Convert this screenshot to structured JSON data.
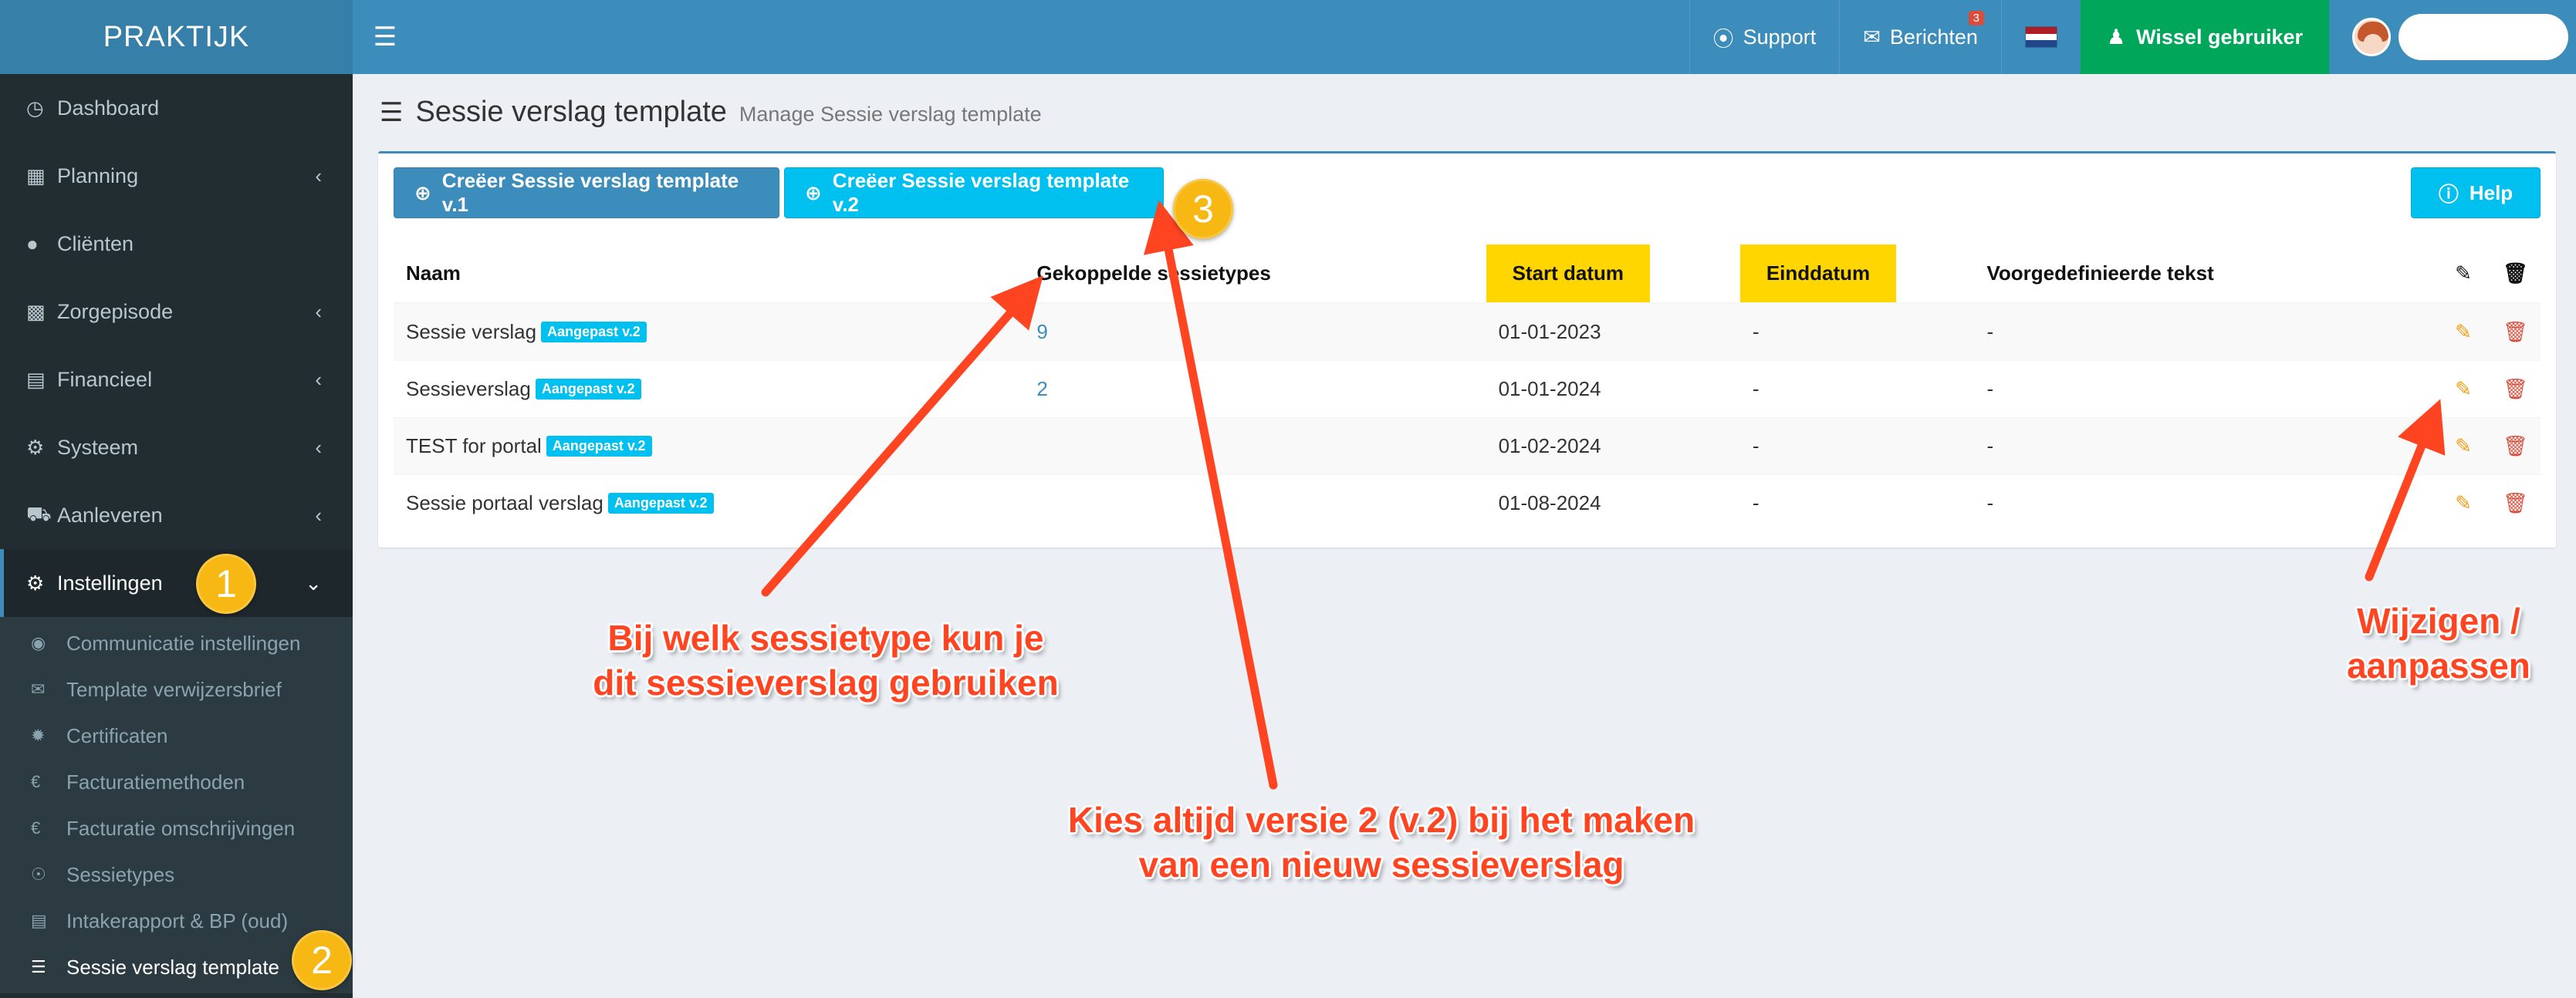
{
  "app": {
    "logo": "PRAKTIJK"
  },
  "topbar": {
    "support_label": "Support",
    "berichten_label": "Berichten",
    "berichten_count": "3",
    "wissel_label": "Wissel gebruiker"
  },
  "sidebar": {
    "items": [
      {
        "label": "Dashboard"
      },
      {
        "label": "Planning"
      },
      {
        "label": "Cliënten"
      },
      {
        "label": "Zorgepisode"
      },
      {
        "label": "Financieel"
      },
      {
        "label": "Systeem"
      },
      {
        "label": "Aanleveren"
      },
      {
        "label": "Instellingen"
      }
    ],
    "submenu": [
      {
        "label": "Communicatie instellingen"
      },
      {
        "label": "Template verwijzersbrief"
      },
      {
        "label": "Certificaten"
      },
      {
        "label": "Facturatiemethoden"
      },
      {
        "label": "Facturatie omschrijvingen"
      },
      {
        "label": "Sessietypes"
      },
      {
        "label": "Intakerapport & BP (oud)"
      },
      {
        "label": "Sessie verslag template"
      }
    ]
  },
  "page": {
    "title": "Sessie verslag template",
    "subtitle": "Manage Sessie verslag template"
  },
  "toolbar": {
    "create_v1": "Creëer Sessie verslag template v.1",
    "create_v2": "Creëer Sessie verslag template v.2",
    "help": "Help"
  },
  "table": {
    "headers": {
      "naam": "Naam",
      "gekoppelde": "Gekoppelde sessietypes",
      "start": "Start datum",
      "eind": "Einddatum",
      "voorgedefinieerd": "Voorgedefinieerde tekst"
    },
    "rows": [
      {
        "naam": "Sessie verslag",
        "badge": "Aangepast v.2",
        "gekoppelde": "9",
        "start": "01-01-2023",
        "eind": "-",
        "voor": "-"
      },
      {
        "naam": "Sessieverslag",
        "badge": "Aangepast v.2",
        "gekoppelde": "2",
        "start": "01-01-2024",
        "eind": "-",
        "voor": "-"
      },
      {
        "naam": "TEST for portal",
        "badge": "Aangepast v.2",
        "gekoppelde": "",
        "start": "01-02-2024",
        "eind": "-",
        "voor": "-"
      },
      {
        "naam": "Sessie portaal verslag",
        "badge": "Aangepast v.2",
        "gekoppelde": "",
        "start": "01-08-2024",
        "eind": "-",
        "voor": "-"
      }
    ]
  },
  "annotations": {
    "markers": [
      "1",
      "2",
      "3"
    ],
    "sessietype_line1": "Bij welk sessietype kun je",
    "sessietype_line2": "dit sessieverslag gebruiken",
    "versie_line1": "Kies altijd versie 2 (v.2) bij het maken",
    "versie_line2": "van een nieuw sessieverslag",
    "wijzigen_line1": "Wijzigen /",
    "wijzigen_line2": "aanpassen"
  },
  "icons": {
    "hamburger": "menu-icon",
    "support": "lifebuoy-icon",
    "berichten": "envelope-icon",
    "wissel": "user-secret-icon",
    "edit": "pencil-icon",
    "delete": "trash-icon"
  },
  "colors": {
    "header": "#3c8dbc",
    "logo_bg": "#367fa9",
    "sidebar": "#222d32",
    "wissel_bg": "#00a65a",
    "info_button": "#00c0ef",
    "highlight": "#ffd600",
    "annotation": "#ff4422",
    "marker": "#f7b814"
  }
}
